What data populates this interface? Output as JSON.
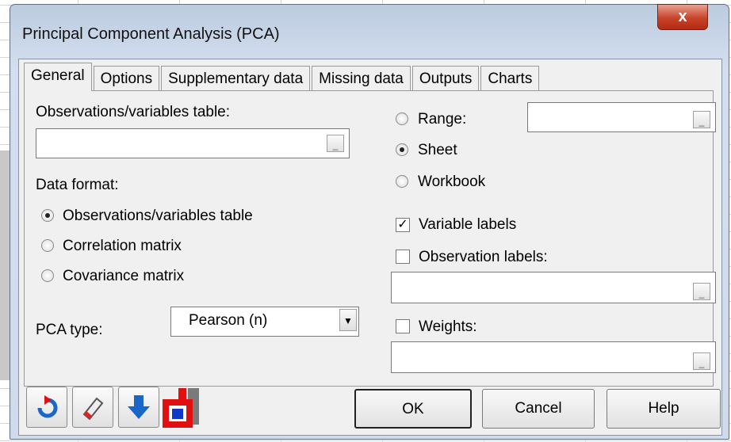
{
  "window": {
    "title": "Principal Component Analysis (PCA)",
    "close_label": "x"
  },
  "tabs": [
    "General",
    "Options",
    "Supplementary data",
    "Missing data",
    "Outputs",
    "Charts"
  ],
  "general": {
    "obs_table_label": "Observations/variables table:",
    "obs_table_value": "",
    "range_label": "Range:",
    "range_value": "",
    "sheet_label": "Sheet",
    "workbook_label": "Workbook",
    "data_format_label": "Data format:",
    "format_obs": "Observations/variables table",
    "format_corr": "Correlation matrix",
    "format_cov": "Covariance matrix",
    "pca_type_label": "PCA type:",
    "pca_type_value": "Pearson (n)",
    "variable_labels": "Variable labels",
    "observation_labels": "Observation labels:",
    "observation_labels_value": "",
    "weights": "Weights:",
    "weights_value": "",
    "ellipsis": "_"
  },
  "buttons": {
    "ok": "OK",
    "cancel": "Cancel",
    "help": "Help"
  },
  "icons": [
    "reload-icon",
    "eraser-icon",
    "arrow-down-icon",
    "layout-toggle-icon"
  ]
}
